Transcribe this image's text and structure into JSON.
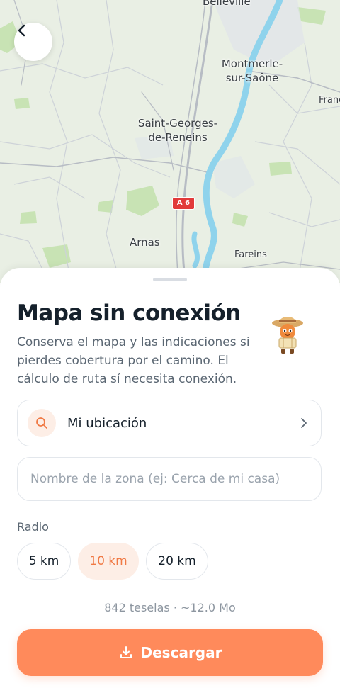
{
  "map": {
    "places": [
      {
        "name": "Belleville"
      },
      {
        "name": "Montmerle-\nsur-Saône"
      },
      {
        "name": "Franc"
      },
      {
        "name": "Saint-Georges-\nde-Reneins"
      },
      {
        "name": "Arnas"
      },
      {
        "name": "Fareins"
      }
    ],
    "road_shield": "A 6",
    "colors": {
      "land": "#e9efe4",
      "park": "#c8e3b4",
      "water": "#8fd3ec",
      "road": "#b7bcc4",
      "boundary": "#cdd2d8"
    }
  },
  "sheet": {
    "title": "Mapa sin conexión",
    "description": "Conserva el mapa y las indicaciones si pierdes cobertura por el camino. El cálculo de ruta sí necesita conexión.",
    "location": {
      "icon": "search-icon",
      "label": "Mi ubicación"
    },
    "zone_input": {
      "placeholder": "Nombre de la zona (ej: Cerca de mi casa)",
      "value": ""
    },
    "radius": {
      "label": "Radio",
      "options": [
        "5 km",
        "10 km",
        "20 km"
      ],
      "selected": "10 km"
    },
    "stats": "842 teselas · ~12.0 Mo",
    "download": {
      "icon": "download-icon",
      "label": "Descargar"
    }
  },
  "colors": {
    "accent": "#ff8a5b",
    "accent_soft": "#fdeee6",
    "accent_text": "#f07a45",
    "text": "#15202b",
    "muted": "#5b6773"
  }
}
